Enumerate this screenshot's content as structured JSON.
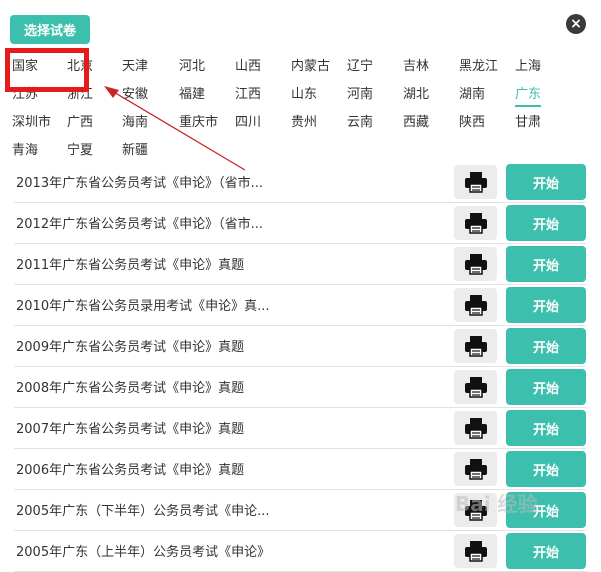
{
  "header": {
    "title": "选择试卷",
    "close_glyph": "×"
  },
  "regions": [
    {
      "label": "国家",
      "active": false
    },
    {
      "label": "北京",
      "active": false
    },
    {
      "label": "天津",
      "active": false
    },
    {
      "label": "河北",
      "active": false
    },
    {
      "label": "山西",
      "active": false
    },
    {
      "label": "内蒙古",
      "active": false
    },
    {
      "label": "辽宁",
      "active": false
    },
    {
      "label": "吉林",
      "active": false
    },
    {
      "label": "黑龙江",
      "active": false
    },
    {
      "label": "上海",
      "active": false
    },
    {
      "label": "江苏",
      "active": false
    },
    {
      "label": "浙江",
      "active": false
    },
    {
      "label": "安徽",
      "active": false
    },
    {
      "label": "福建",
      "active": false
    },
    {
      "label": "江西",
      "active": false
    },
    {
      "label": "山东",
      "active": false
    },
    {
      "label": "河南",
      "active": false
    },
    {
      "label": "湖北",
      "active": false
    },
    {
      "label": "湖南",
      "active": false
    },
    {
      "label": "广东",
      "active": true
    },
    {
      "label": "深圳市",
      "active": false
    },
    {
      "label": "广西",
      "active": false
    },
    {
      "label": "海南",
      "active": false
    },
    {
      "label": "重庆市",
      "active": false
    },
    {
      "label": "四川",
      "active": false
    },
    {
      "label": "贵州",
      "active": false
    },
    {
      "label": "云南",
      "active": false
    },
    {
      "label": "西藏",
      "active": false
    },
    {
      "label": "陕西",
      "active": false
    },
    {
      "label": "甘肃",
      "active": false
    },
    {
      "label": "青海",
      "active": false
    },
    {
      "label": "宁夏",
      "active": false
    },
    {
      "label": "新疆",
      "active": false
    }
  ],
  "papers": [
    {
      "title": "2013年广东省公务员考试《申论》（省市..."
    },
    {
      "title": "2012年广东省公务员考试《申论》（省市..."
    },
    {
      "title": "2011年广东省公务员考试《申论》真题"
    },
    {
      "title": "2010年广东省公务员录用考试《申论》真..."
    },
    {
      "title": "2009年广东省公务员考试《申论》真题"
    },
    {
      "title": "2008年广东省公务员考试《申论》真题"
    },
    {
      "title": "2007年广东省公务员考试《申论》真题"
    },
    {
      "title": "2006年广东省公务员考试《申论》真题"
    },
    {
      "title": "2005年广东（下半年）公务员考试《申论..."
    },
    {
      "title": "2005年广东（上半年）公务员考试《申论》"
    }
  ],
  "actions": {
    "start_label": "开始"
  },
  "colors": {
    "accent": "#3dbfad",
    "annotation": "#e51b1b"
  },
  "watermark": {
    "text": "Bai 经验"
  }
}
